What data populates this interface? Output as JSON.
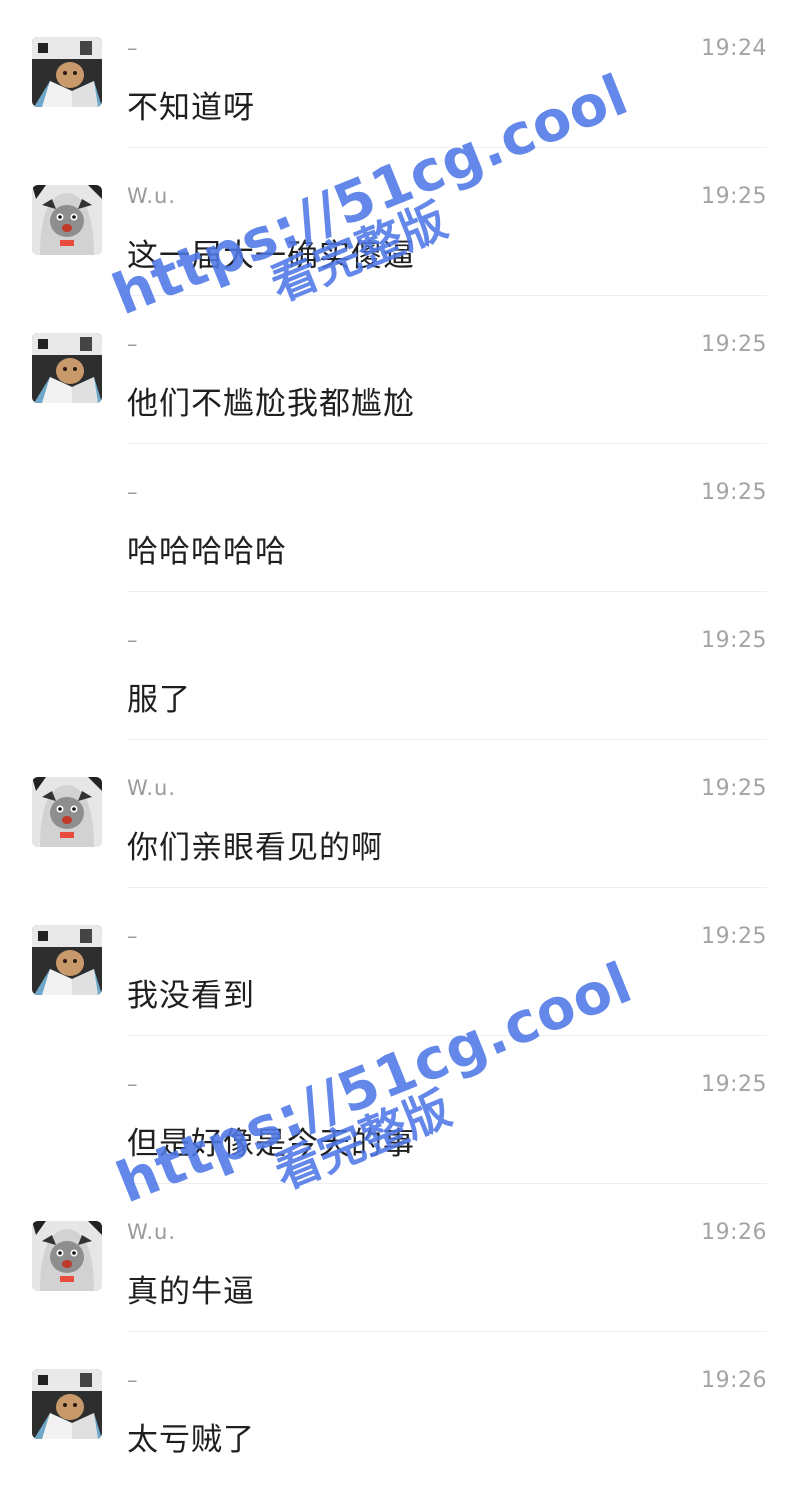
{
  "messages": [
    {
      "avatar": "book-person",
      "sender": "–",
      "time": "19:24",
      "text": "不知道呀",
      "show_avatar": true
    },
    {
      "avatar": "hooded-cat",
      "sender": "W.u.",
      "time": "19:25",
      "text": "这一届大一确实傻逼",
      "show_avatar": true
    },
    {
      "avatar": "book-person",
      "sender": "–",
      "time": "19:25",
      "text": "他们不尴尬我都尴尬",
      "show_avatar": true
    },
    {
      "avatar": "book-person",
      "sender": "–",
      "time": "19:25",
      "text": "哈哈哈哈哈",
      "show_avatar": false
    },
    {
      "avatar": "book-person",
      "sender": "–",
      "time": "19:25",
      "text": "服了",
      "show_avatar": false
    },
    {
      "avatar": "hooded-cat",
      "sender": "W.u.",
      "time": "19:25",
      "text": "你们亲眼看见的啊",
      "show_avatar": true
    },
    {
      "avatar": "book-person",
      "sender": "–",
      "time": "19:25",
      "text": "我没看到",
      "show_avatar": true
    },
    {
      "avatar": "book-person",
      "sender": "–",
      "time": "19:25",
      "text": "但是好像是今天的事",
      "show_avatar": false
    },
    {
      "avatar": "hooded-cat",
      "sender": "W.u.",
      "time": "19:26",
      "text": "真的牛逼",
      "show_avatar": true
    },
    {
      "avatar": "book-person",
      "sender": "–",
      "time": "19:26",
      "text": "太亏贼了",
      "show_avatar": true
    }
  ],
  "watermarks": [
    {
      "url": "https://51cg.cool",
      "sub": "看完整版"
    },
    {
      "url": "https://51cg.cool",
      "sub": "看完整版"
    }
  ],
  "colors": {
    "watermark": "#4f78e6",
    "sender": "#9a9a9a",
    "time": "#a4a4a4",
    "message_text": "#1f1f1f",
    "divider": "#eeeeee"
  }
}
